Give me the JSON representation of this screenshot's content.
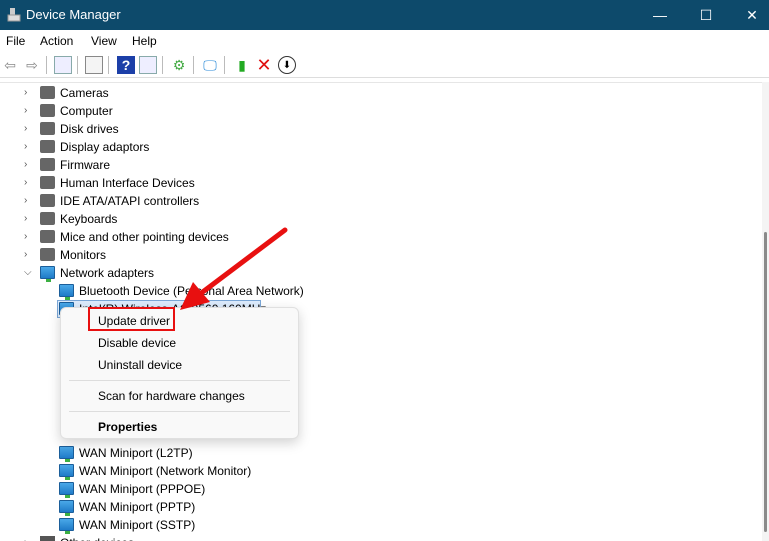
{
  "window": {
    "title": "Device Manager",
    "minimize": "—",
    "maximize": "☐",
    "close": "✕"
  },
  "menu": [
    "File",
    "Action",
    "View",
    "Help"
  ],
  "toolbar": [
    "back-icon",
    "forward-icon",
    "show-hide-console-tree-icon",
    "properties-icon",
    "help-icon",
    "action-pane-icon",
    "update-driver-icon",
    "scan-hardware-icon",
    "enable-device-icon",
    "uninstall-icon",
    "disable-device-icon"
  ],
  "tree": {
    "categories": [
      "Cameras",
      "Computer",
      "Disk drives",
      "Display adaptors",
      "Firmware",
      "Human Interface Devices",
      "IDE ATA/ATAPI controllers",
      "Keyboards",
      "Mice and other pointing devices",
      "Monitors",
      "Network adapters"
    ],
    "network_children": [
      "Bluetooth Device (Personal Area Network)",
      "Intel(R) Wireless-AC 9560 160MHz"
    ],
    "network_children_below": [
      "WAN Miniport (L2TP)",
      "WAN Miniport (Network Monitor)",
      "WAN Miniport (PPPOE)",
      "WAN Miniport (PPTP)",
      "WAN Miniport (SSTP)"
    ],
    "next_category": "Other devices"
  },
  "context_menu": {
    "items": [
      "Update driver",
      "Disable device",
      "Uninstall device",
      "Scan for hardware changes",
      "Properties"
    ]
  },
  "colors": {
    "titlebar": "#0d4a6b",
    "highlight": "#e81010"
  }
}
